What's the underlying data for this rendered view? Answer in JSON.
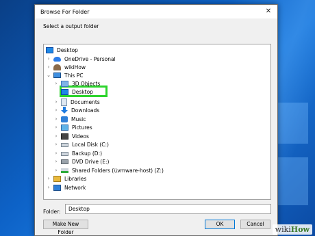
{
  "window": {
    "title": "Browse For Folder",
    "close_glyph": "✕"
  },
  "prompt": "Select a output folder",
  "tree": [
    {
      "label": "Desktop",
      "icon": "desktop-icon",
      "chevron": ""
    },
    {
      "label": "OneDrive - Personal",
      "icon": "cloud-icon",
      "chevron": "›"
    },
    {
      "label": "wikiHow",
      "icon": "user-icon",
      "chevron": "›"
    },
    {
      "label": "This PC",
      "icon": "computer-icon",
      "chevron": "⌄"
    },
    {
      "label": "3D Objects",
      "icon": "3d-objects-icon",
      "chevron": "›"
    },
    {
      "label": "Desktop",
      "icon": "desktop-icon",
      "chevron": ""
    },
    {
      "label": "Documents",
      "icon": "documents-icon",
      "chevron": "›"
    },
    {
      "label": "Downloads",
      "icon": "downloads-icon",
      "chevron": "›"
    },
    {
      "label": "Music",
      "icon": "music-icon",
      "chevron": "›"
    },
    {
      "label": "Pictures",
      "icon": "pictures-icon",
      "chevron": "›"
    },
    {
      "label": "Videos",
      "icon": "videos-icon",
      "chevron": "›"
    },
    {
      "label": "Local Disk (C:)",
      "icon": "local-disk-icon",
      "chevron": "›"
    },
    {
      "label": "Backup (D:)",
      "icon": "drive-icon",
      "chevron": "›"
    },
    {
      "label": "DVD Drive (E:)",
      "icon": "dvd-drive-icon",
      "chevron": "›"
    },
    {
      "label": "Shared Folders (\\\\vmware-host) (Z:)",
      "icon": "network-drive-icon",
      "chevron": "›"
    },
    {
      "label": "Libraries",
      "icon": "libraries-icon",
      "chevron": "›"
    },
    {
      "label": "Network",
      "icon": "network-icon",
      "chevron": "›"
    }
  ],
  "folder": {
    "label": "Folder:",
    "value": "Desktop"
  },
  "buttons": {
    "new_folder": "Make New Folder",
    "ok": "OK",
    "cancel": "Cancel"
  },
  "watermark": {
    "part1": "wiki",
    "part2": "How"
  },
  "colors": {
    "highlight": "#2cd42c",
    "desktop_bg": "#0d62c7"
  }
}
